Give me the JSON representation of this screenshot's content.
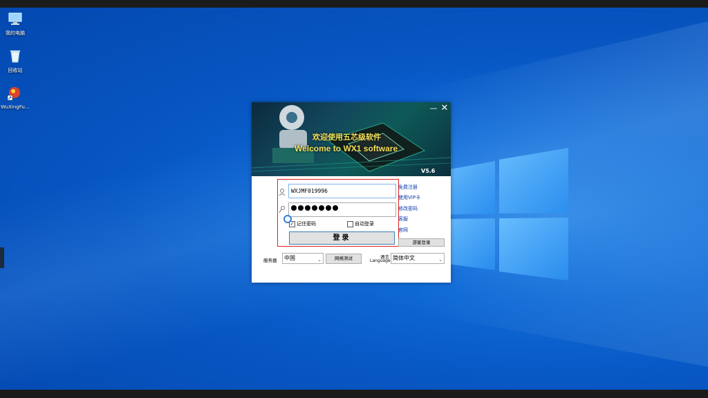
{
  "desktop": {
    "icons": [
      {
        "label": "我的电脑",
        "icon": "computer-icon"
      },
      {
        "label": "回收站",
        "icon": "recycle-bin-icon"
      },
      {
        "label": "WuXingFu...",
        "icon": "app-shortcut-icon"
      }
    ]
  },
  "dialog": {
    "banner_title": "欢迎使用五芯级软件",
    "banner_subtitle": "Welcome to WX1 software",
    "version": "V5.6",
    "username_value": "WXJMF019996",
    "password_dots": 7,
    "remember_label": "记住密码",
    "auto_login_label": "自动登录",
    "login_label": "登录",
    "links": [
      "免费注册",
      "使用VIP卡",
      "修改密码",
      "客服",
      "官网"
    ],
    "guest_login_label": "游客登录",
    "server_label": "服务器",
    "server_value": "中国",
    "network_test_label": "网络测试",
    "language_label_cn": "语言",
    "language_label_en": "Language",
    "language_value": "简体中文"
  },
  "colors": {
    "highlight_box": "#e02020",
    "desktop_blue": "#0757c4"
  }
}
